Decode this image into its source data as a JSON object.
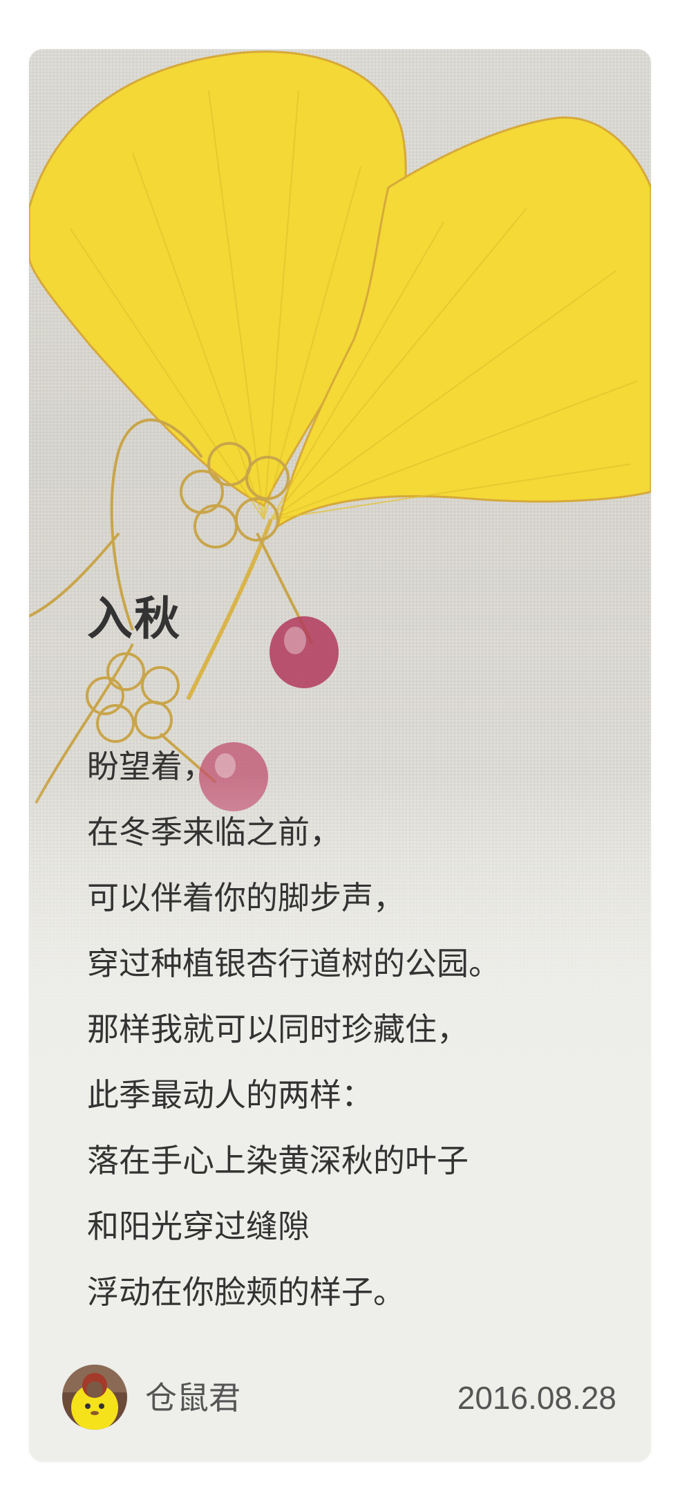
{
  "post": {
    "title": "入秋",
    "lines": [
      "盼望着，",
      "在冬季来临之前，",
      "可以伴着你的脚步声，",
      "穿过种植银杏行道树的公园。",
      "那样我就可以同时珍藏住，",
      "此季最动人的两样：",
      "落在手心上染黄深秋的叶子",
      "和阳光穿过缝隙",
      "浮动在你脸颊的样子。"
    ]
  },
  "footer": {
    "author": "仓鼠君",
    "date": "2016.08.28",
    "avatar_icon": "hamster-avatar"
  },
  "colors": {
    "leaf": "#f2d633",
    "card_bg": "#eeeeea",
    "text": "#333333",
    "bead": "#b23a5c"
  }
}
